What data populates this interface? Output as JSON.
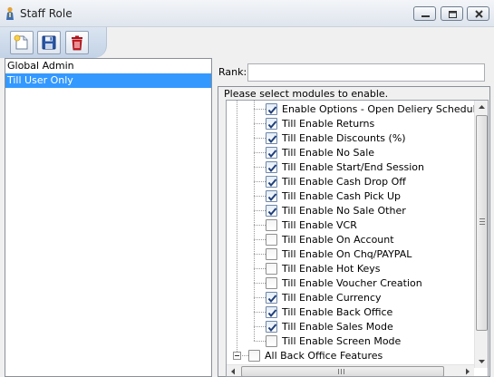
{
  "window": {
    "title": "Staff Role"
  },
  "toolbar": {
    "buttons": [
      {
        "name": "new",
        "icon": "new-document-icon"
      },
      {
        "name": "save",
        "icon": "floppy-disk-icon"
      },
      {
        "name": "delete",
        "icon": "trash-can-icon"
      }
    ]
  },
  "roles": [
    {
      "label": "Global Admin",
      "selected": false
    },
    {
      "label": "Till User Only",
      "selected": true
    }
  ],
  "rank": {
    "label": "Rank:",
    "value": ""
  },
  "modules": {
    "caption": "Please select modules to enable.",
    "items": [
      {
        "label": "Enable Options - Open Deliery Schedule",
        "checked": true,
        "level": 2
      },
      {
        "label": "Till Enable Returns",
        "checked": true,
        "level": 2
      },
      {
        "label": "Till Enable Discounts (%)",
        "checked": true,
        "level": 2
      },
      {
        "label": "Till Enable No Sale",
        "checked": true,
        "level": 2
      },
      {
        "label": "Till Enable Start/End Session",
        "checked": true,
        "level": 2
      },
      {
        "label": "Till Enable Cash Drop Off",
        "checked": true,
        "level": 2
      },
      {
        "label": "Till Enable Cash Pick Up",
        "checked": true,
        "level": 2
      },
      {
        "label": "Till Enable No Sale Other",
        "checked": true,
        "level": 2
      },
      {
        "label": "Till Enable VCR",
        "checked": false,
        "level": 2
      },
      {
        "label": "Till Enable On Account",
        "checked": false,
        "level": 2
      },
      {
        "label": "Till Enable On Chq/PAYPAL",
        "checked": false,
        "level": 2
      },
      {
        "label": "Till Enable Hot Keys",
        "checked": false,
        "level": 2
      },
      {
        "label": "Till Enable Voucher Creation",
        "checked": false,
        "level": 2
      },
      {
        "label": "Till Enable Currency",
        "checked": true,
        "level": 2
      },
      {
        "label": "Till Enable Back Office",
        "checked": true,
        "level": 2
      },
      {
        "label": "Till Enable Sales Mode",
        "checked": true,
        "level": 2
      },
      {
        "label": "Till Enable Screen Mode",
        "checked": false,
        "level": 2
      },
      {
        "label": "All Back Office Features",
        "checked": false,
        "level": 1,
        "expander": true
      }
    ]
  },
  "colors": {
    "selection": "#3399ff",
    "window_border": "#8a9099"
  }
}
